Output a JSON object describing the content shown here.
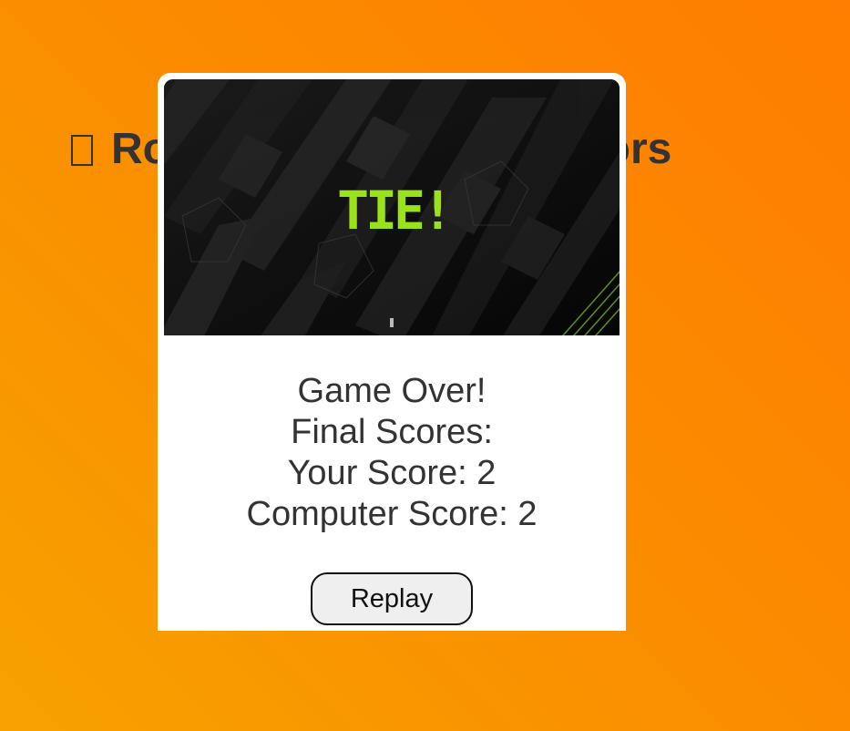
{
  "page": {
    "heading_visible_left": "Ro",
    "heading_visible_right": "sors",
    "heading_glyph_icon": "missing-glyph-box-icon"
  },
  "modal": {
    "banner": {
      "result_text": "TIE!",
      "result_color": "#9ae21a",
      "background_color": "#0c0c0c"
    },
    "summary": {
      "game_over": "Game Over!",
      "final_scores": "Final Scores:",
      "your_score": "Your Score: 2",
      "computer_score": "Computer Score: 2"
    },
    "replay_label": "Replay"
  },
  "colors": {
    "background_start": "#f7a100",
    "background_end": "#ff7d00",
    "text": "#333333"
  }
}
